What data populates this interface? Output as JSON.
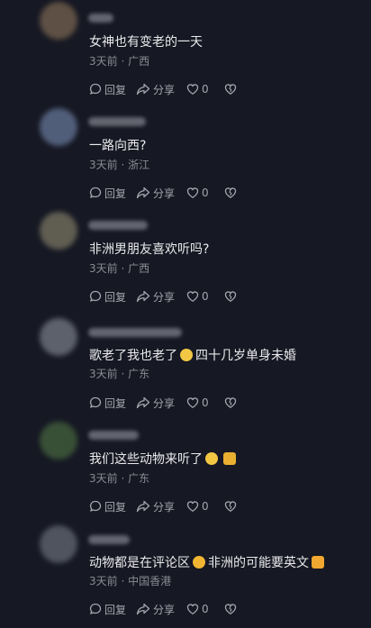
{
  "labels": {
    "reply": "回复",
    "share": "分享"
  },
  "comments": [
    {
      "text": "女神也有变老的一天",
      "time": "3天前",
      "location": "广西",
      "likes": "0",
      "avatar_color": "#6b5a4a",
      "username_color": "#7d7f8a"
    },
    {
      "text": "一路向西?",
      "time": "3天前",
      "location": "浙江",
      "likes": "0",
      "avatar_color": "#5c6b8a",
      "username_color": "#7d7f8a"
    },
    {
      "text": "非洲男朋友喜欢听吗?",
      "time": "3天前",
      "location": "广西",
      "likes": "0",
      "avatar_color": "#6d6a5a",
      "username_color": "#7d7f8a"
    },
    {
      "text_before": "歌老了我也老了",
      "text_after": "四十几岁单身未婚",
      "time": "3天前",
      "location": "广东",
      "likes": "0",
      "avatar_color": "#6a6e78",
      "username_color": "#7d7f8a",
      "emoji_color": "#f2c744"
    },
    {
      "text_before": "我们这些动物来听了",
      "text_after": "",
      "time": "3天前",
      "location": "广东",
      "likes": "0",
      "avatar_color": "#3f5a3a",
      "username_color": "#7d7f8a",
      "emoji_color": "#f2c744",
      "emoji2_color": "#e8b030"
    },
    {
      "text_before": "动物都是在评论区",
      "text_after": "非洲的可能要英文",
      "time": "3天前",
      "location": "中国香港",
      "likes": "0",
      "avatar_color": "#5a5f6a",
      "username_color": "#7d7f8a",
      "emoji_color": "#f2b632",
      "emoji2_color": "#f0a830"
    }
  ]
}
